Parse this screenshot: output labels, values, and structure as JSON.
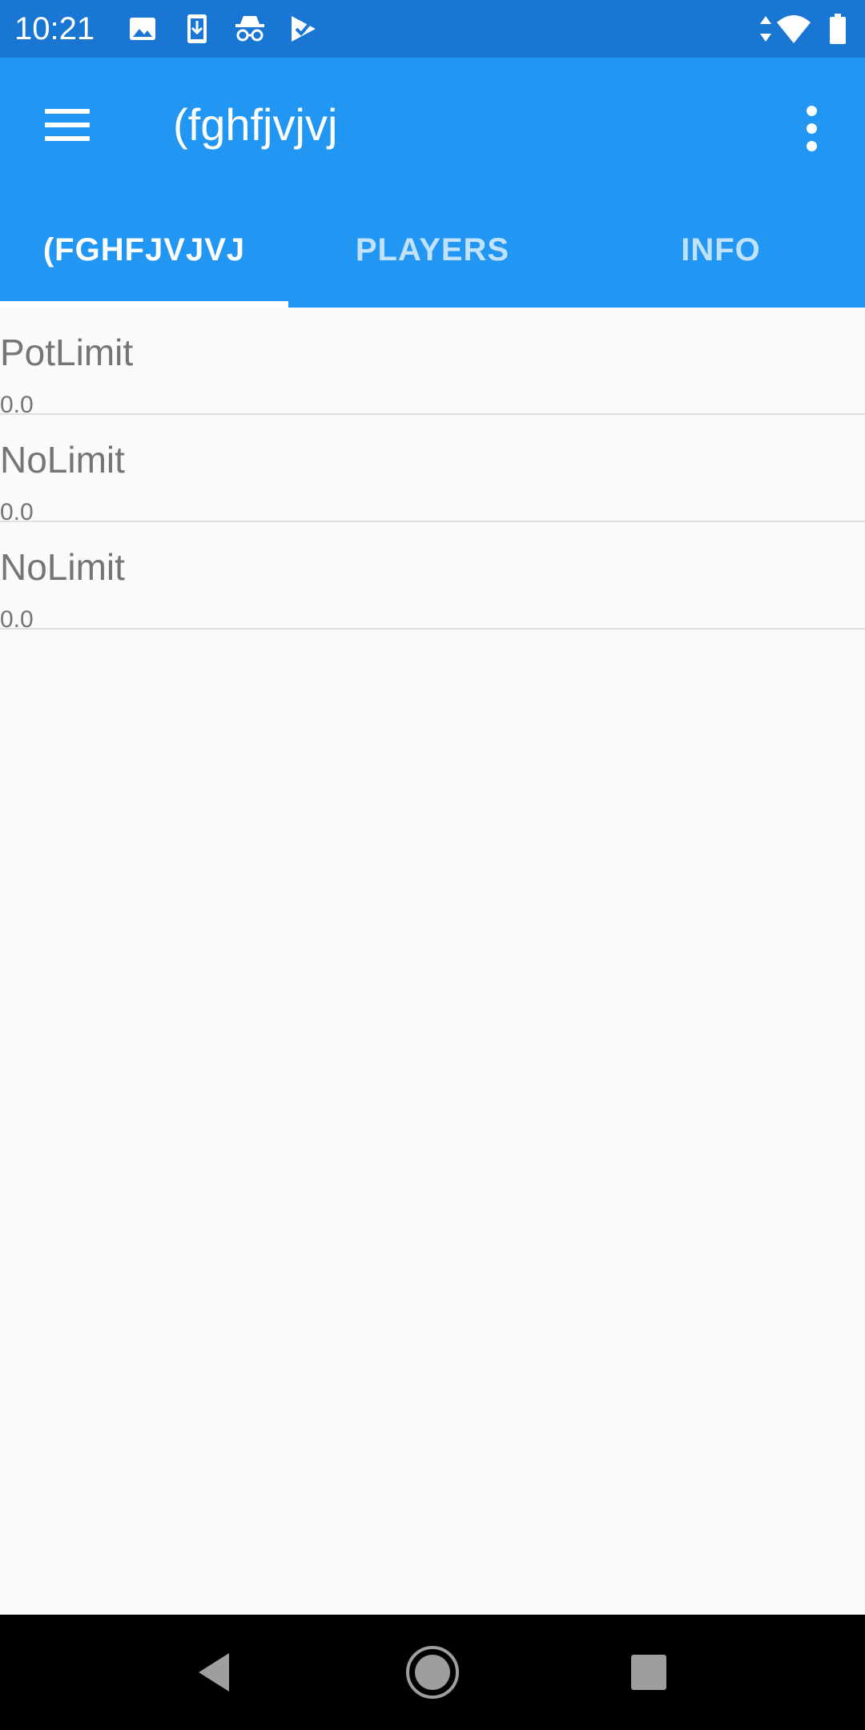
{
  "status_bar": {
    "time": "10:21",
    "icons": [
      "image-icon",
      "download-icon",
      "incognito-icon",
      "play-games-icon",
      "data-arrows-icon",
      "wifi-icon",
      "battery-icon"
    ]
  },
  "app_bar": {
    "title": "(fghfjvjvj",
    "menu_icon": "hamburger-menu-icon",
    "overflow_icon": "more-vert-icon",
    "color": "#2196f3",
    "status_color": "#1976d2"
  },
  "tabs": [
    {
      "label": "(FGHFJVJVJ",
      "active": true
    },
    {
      "label": "PLAYERS",
      "active": false
    },
    {
      "label": "INFO",
      "active": false
    }
  ],
  "list": [
    {
      "title": "PotLimit",
      "subtitle": "0.0"
    },
    {
      "title": "NoLimit",
      "subtitle": "0.0"
    },
    {
      "title": "NoLimit",
      "subtitle": "0.0"
    }
  ],
  "nav_bar": {
    "icons": [
      "back-icon",
      "home-icon",
      "recents-icon"
    ]
  }
}
